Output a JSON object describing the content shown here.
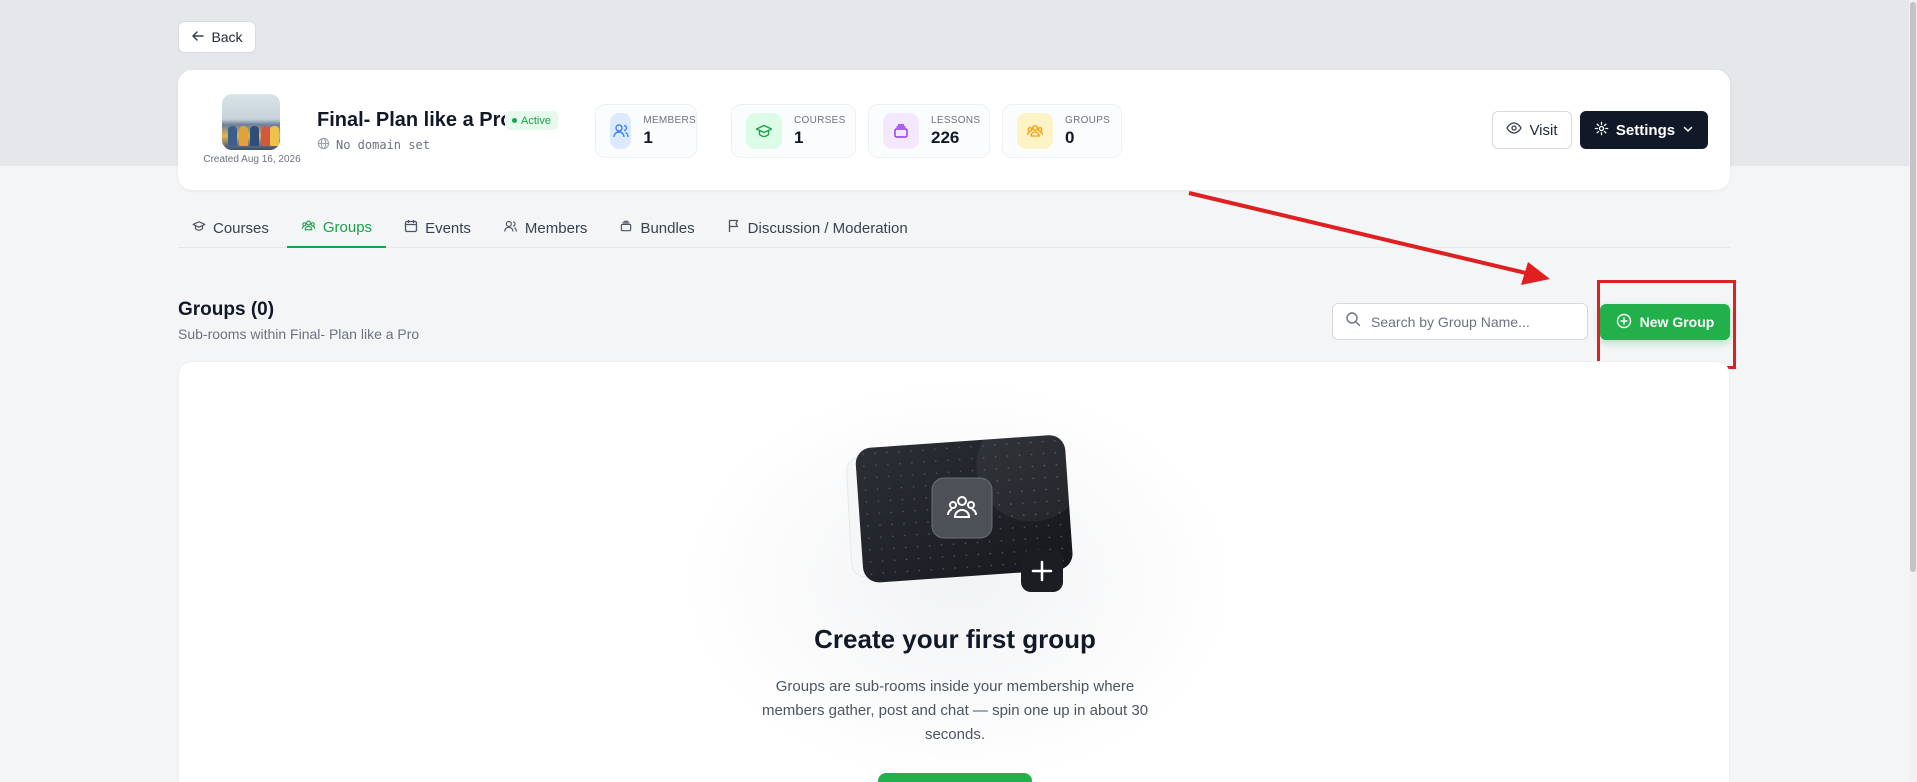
{
  "back_label": "Back",
  "header": {
    "created": "Created Aug 16, 2026",
    "title": "Final- Plan like a Pro",
    "status": "Active",
    "domain": "No domain set",
    "stats": [
      {
        "label": "MEMBERS",
        "value": "1",
        "icon": "members-icon",
        "color": "#dbeafe",
        "icon_color": "#3b82f6"
      },
      {
        "label": "COURSES",
        "value": "1",
        "icon": "graduation-cap-icon",
        "color": "#dcfce7",
        "icon_color": "#16a34a"
      },
      {
        "label": "LESSONS",
        "value": "226",
        "icon": "layers-icon",
        "color": "#f3e8ff",
        "icon_color": "#9333ea"
      },
      {
        "label": "GROUPS",
        "value": "0",
        "icon": "group-icon",
        "color": "#fef3c7",
        "icon_color": "#f59e0b"
      }
    ],
    "visit_label": "Visit",
    "settings_label": "Settings"
  },
  "tabs": [
    {
      "label": "Courses",
      "icon": "graduation-cap-icon"
    },
    {
      "label": "Groups",
      "icon": "group-icon",
      "active": true
    },
    {
      "label": "Events",
      "icon": "calendar-icon"
    },
    {
      "label": "Members",
      "icon": "members-icon"
    },
    {
      "label": "Bundles",
      "icon": "bundle-icon"
    },
    {
      "label": "Discussion / Moderation",
      "icon": "flag-icon"
    }
  ],
  "groups": {
    "title": "Groups (0)",
    "subtitle": "Sub-rooms within Final- Plan like a Pro",
    "search_placeholder": "Search by Group Name...",
    "new_group_label": "New Group"
  },
  "empty_state": {
    "title": "Create your first group",
    "description": "Groups are sub-rooms inside your membership where members gather, post and chat — spin one up in about 30 seconds."
  },
  "colors": {
    "accent_green": "#22b04b",
    "dark": "#111827",
    "annotation_red": "#e02020"
  }
}
